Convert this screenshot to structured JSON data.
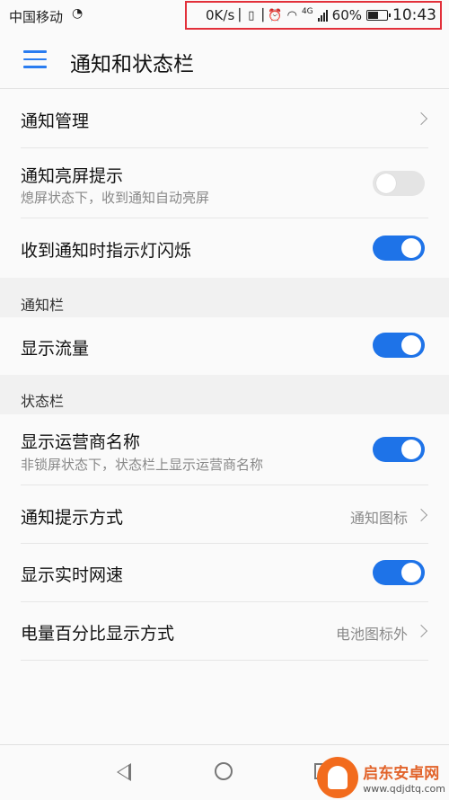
{
  "status_bar": {
    "carrier": "中国移动",
    "net_speed": "0K/s",
    "network": "4G",
    "battery_percent": "60%",
    "battery_level": 0.6,
    "time": "10:43",
    "icons": [
      "data-saver-icon",
      "vibrate-icon",
      "alarm-icon",
      "wifi-icon",
      "signal-icon",
      "battery-icon"
    ],
    "highlight_color": "#e2303a"
  },
  "app_bar": {
    "title": "通知和状态栏"
  },
  "rows": {
    "notification_management": {
      "title": "通知管理"
    },
    "wake_screen": {
      "title": "通知亮屏提示",
      "subtitle": "熄屏状态下，收到通知自动亮屏",
      "enabled": false
    },
    "led_blink": {
      "title": "收到通知时指示灯闪烁",
      "enabled": true
    },
    "show_traffic": {
      "title": "显示流量",
      "enabled": true
    },
    "carrier_name": {
      "title": "显示运营商名称",
      "subtitle": "非锁屏状态下，状态栏上显示运营商名称",
      "enabled": true
    },
    "notify_style": {
      "title": "通知提示方式",
      "value": "通知图标"
    },
    "realtime_speed": {
      "title": "显示实时网速",
      "enabled": true
    },
    "battery_percent_style": {
      "title": "电量百分比显示方式",
      "value": "电池图标外"
    }
  },
  "sections": {
    "notification_bar": "通知栏",
    "status_bar": "状态栏"
  },
  "watermark": {
    "name": "启东安卓网",
    "url": "www.qdjdtq.com"
  },
  "colors": {
    "accent": "#1e73e8",
    "toggle_off": "#e4e4e4"
  }
}
